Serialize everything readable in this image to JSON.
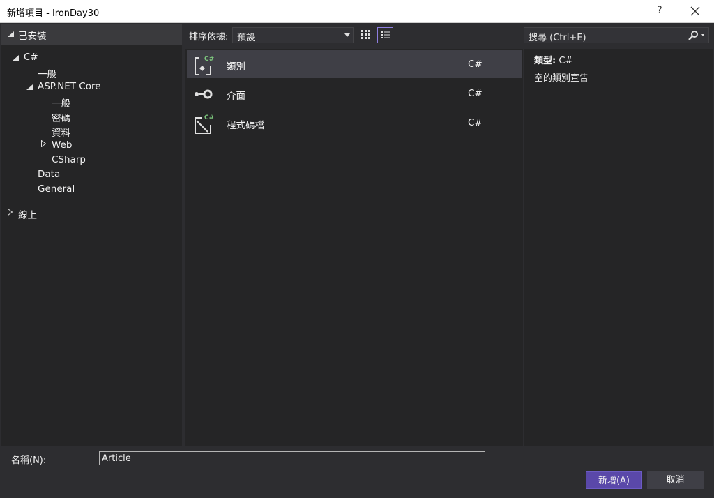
{
  "window": {
    "title": "新增項目 - IronDay30",
    "help_label": "?"
  },
  "tree": {
    "installed": "已安裝",
    "csharp": "C#",
    "general": "一般",
    "aspnet_core": "ASP.NET Core",
    "asp_general": "一般",
    "asp_password": "密碼",
    "asp_data": "資料",
    "asp_web": "Web",
    "asp_csharp": "CSharp",
    "data": "Data",
    "general_en": "General",
    "online": "線上"
  },
  "toolbar": {
    "sort_label": "排序依據:",
    "sort_value": "預設"
  },
  "search": {
    "placeholder": "搜尋 (Ctrl+E)"
  },
  "templates": [
    {
      "name": "類別",
      "lang": "C#",
      "icon": "class-icon",
      "selected": true
    },
    {
      "name": "介面",
      "lang": "C#",
      "icon": "interface-icon",
      "selected": false
    },
    {
      "name": "程式碼檔",
      "lang": "C#",
      "icon": "code-file-icon",
      "selected": false
    }
  ],
  "details": {
    "type_label": "類型:",
    "type_value": "C#",
    "description": "空的類別宣告"
  },
  "footer": {
    "name_label": "名稱(N):",
    "name_value": "Article",
    "add_button": "新增(A)",
    "cancel_button": "取消"
  },
  "colors": {
    "accent": "#5a48a9",
    "csharp_badge": "#7ec97e",
    "background": "#2d2d30",
    "panel": "#252526",
    "selection": "#3f3f46"
  }
}
